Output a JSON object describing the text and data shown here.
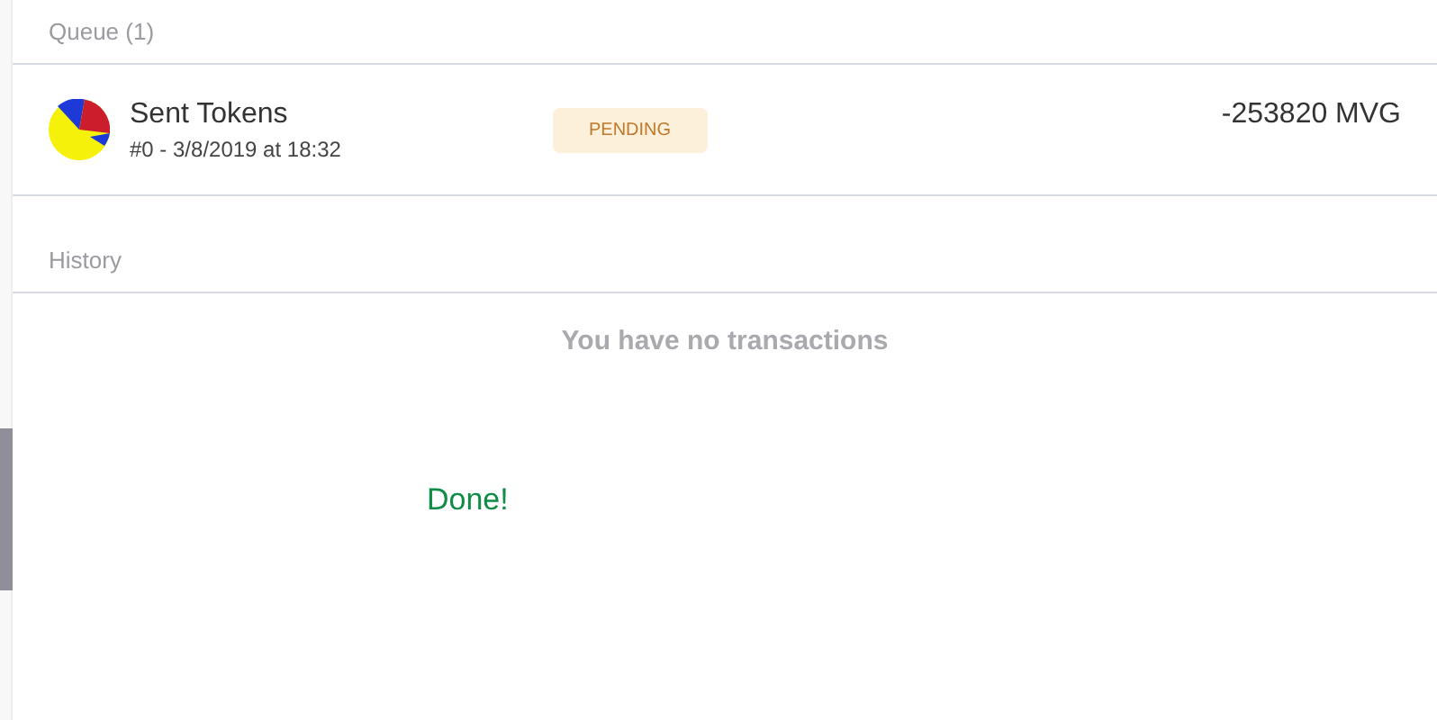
{
  "queue": {
    "title": "Queue (1)",
    "items": [
      {
        "title": "Sent Tokens",
        "subtitle": "#0 - 3/8/2019 at 18:32",
        "status": {
          "label": "PENDING",
          "kind": "pending"
        },
        "amount": "-253820 MVG"
      }
    ]
  },
  "history": {
    "title": "History",
    "empty_message": "You have no transactions"
  },
  "message": "Done!"
}
